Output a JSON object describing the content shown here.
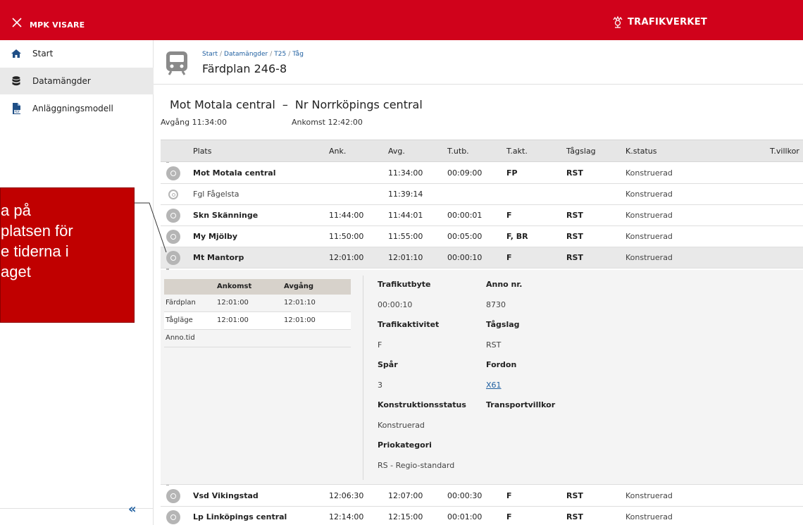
{
  "topbar": {
    "app_title": "MPK VISARE",
    "logo_text": "TRAFIKVERKET",
    "brand_color": "#d0021b"
  },
  "sidebar": {
    "items": [
      {
        "label": "Start",
        "icon": "home-icon"
      },
      {
        "label": "Datamängder",
        "icon": "database-icon"
      },
      {
        "label": "Anläggningsmodell",
        "icon": "pdf-file-icon"
      }
    ],
    "collapse_label": "«"
  },
  "header": {
    "breadcrumb": [
      "Start",
      "Datamängder",
      "T25",
      "Tåg"
    ],
    "title": "Färdplan 246-8"
  },
  "route": {
    "from": "Mot Motala central",
    "dash": "–",
    "to": "Nr Norrköpings central",
    "departure": "Avgång 11:34:00",
    "arrival": "Ankomst 12:42:00"
  },
  "table": {
    "columns": [
      "Plats",
      "Ank.",
      "Avg.",
      "T.utb.",
      "T.akt.",
      "Tågslag",
      "K.status",
      "T.villkor"
    ],
    "rows": [
      {
        "plats": "Mot Motala central",
        "ank": "",
        "avg": "11:34:00",
        "tutb": "00:09:00",
        "takt": "FP",
        "tagslag": "RST",
        "kstatus": "Konstruerad"
      },
      {
        "plats": "Fgl Fågelsta",
        "ank": "",
        "avg": "11:39:14",
        "tutb": "",
        "takt": "",
        "tagslag": "",
        "kstatus": "Konstruerad"
      },
      {
        "plats": "Skn Skänninge",
        "ank": "11:44:00",
        "avg": "11:44:01",
        "tutb": "00:00:01",
        "takt": "F",
        "tagslag": "RST",
        "kstatus": "Konstruerad"
      },
      {
        "plats": "My Mjölby",
        "ank": "11:50:00",
        "avg": "11:55:00",
        "tutb": "00:05:00",
        "takt": "F, BR",
        "tagslag": "RST",
        "kstatus": "Konstruerad"
      },
      {
        "plats": "Mt Mantorp",
        "ank": "12:01:00",
        "avg": "12:01:10",
        "tutb": "00:00:10",
        "takt": "F",
        "tagslag": "RST",
        "kstatus": "Konstruerad"
      },
      {
        "plats": "Vsd Vikingstad",
        "ank": "12:06:30",
        "avg": "12:07:00",
        "tutb": "00:00:30",
        "takt": "F",
        "tagslag": "RST",
        "kstatus": "Konstruerad"
      },
      {
        "plats": "Lp Linköpings central",
        "ank": "12:14:00",
        "avg": "12:15:00",
        "tutb": "00:01:00",
        "takt": "F",
        "tagslag": "RST",
        "kstatus": "Konstruerad"
      }
    ]
  },
  "detail": {
    "subtable": {
      "headers": [
        "Ankomst",
        "Avgång"
      ],
      "rows": [
        {
          "label": "Färdplan",
          "ankomst": "12:01:00",
          "avgang": "12:01:10"
        },
        {
          "label": "Tågläge",
          "ankomst": "12:01:00",
          "avgang": "12:01:00"
        },
        {
          "label": "Anno.tid",
          "ankomst": "",
          "avgang": ""
        }
      ]
    },
    "fields": {
      "trafikutbyte_label": "Trafikutbyte",
      "trafikutbyte": "00:00:10",
      "anno_nr_label": "Anno nr.",
      "anno_nr": "8730",
      "trafikaktivitet_label": "Trafikaktivitet",
      "trafikaktivitet": "F",
      "tagslag_label": "Tågslag",
      "tagslag": "RST",
      "spar_label": "Spår",
      "spar": "3",
      "fordon_label": "Fordon",
      "fordon": "X61",
      "konstruktionsstatus_label": "Konstruktionsstatus",
      "konstruktionsstatus": "Konstruerad",
      "transportvillkor_label": "Transportvillkor",
      "priokategori_label": "Priokategori",
      "priokategori": "RS - Regio-standard"
    }
  },
  "callout": {
    "lines": [
      "a på",
      "platsen för",
      "e tiderna i",
      "aget"
    ]
  }
}
